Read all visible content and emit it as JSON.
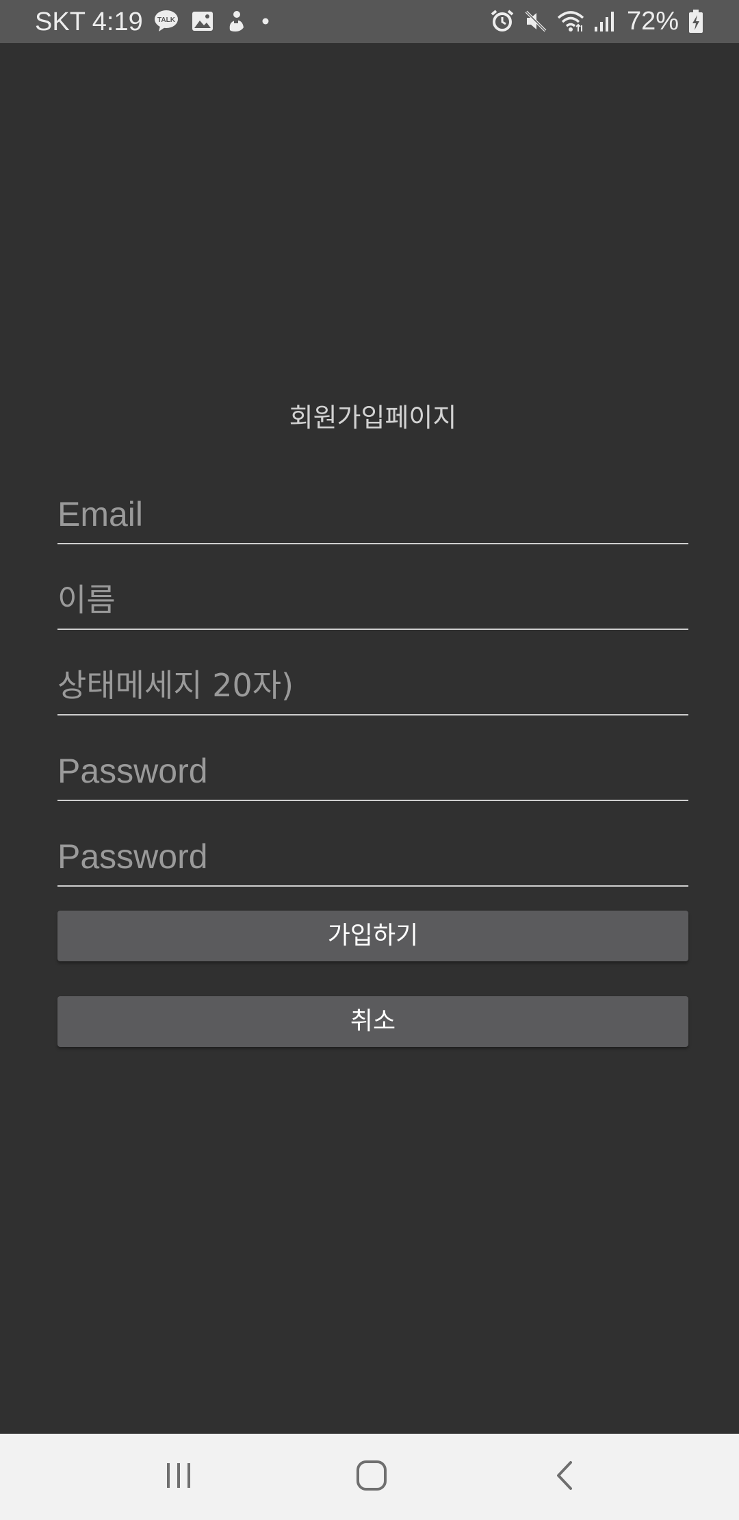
{
  "status_bar": {
    "carrier": "SKT",
    "time": "4:19",
    "battery_percent": "72%",
    "left_icons": [
      "kakaotalk-icon",
      "gallery-icon",
      "app-notification-icon",
      "more-dot-icon"
    ],
    "right_icons": [
      "alarm-icon",
      "mute-icon",
      "wifi-icon",
      "signal-icon",
      "battery-charging-icon"
    ]
  },
  "page": {
    "title": "회원가입페이지"
  },
  "form": {
    "email": {
      "placeholder": "Email",
      "value": ""
    },
    "name": {
      "placeholder": "이름",
      "value": ""
    },
    "status_message": {
      "placeholder": "상태메세지 20자)",
      "value": ""
    },
    "password": {
      "placeholder": "Password",
      "value": ""
    },
    "password_confirm": {
      "placeholder": "Password",
      "value": ""
    }
  },
  "buttons": {
    "signup": "가입하기",
    "cancel": "취소"
  },
  "nav_bar": {
    "icons": [
      "recent-apps-icon",
      "home-icon",
      "back-icon"
    ]
  },
  "colors": {
    "background": "#303030",
    "status_bar": "#575757",
    "button": "#5b5b5d",
    "nav_bar": "#f2f2f2",
    "underline": "#cfcfcf",
    "placeholder": "#9a9a9a"
  }
}
